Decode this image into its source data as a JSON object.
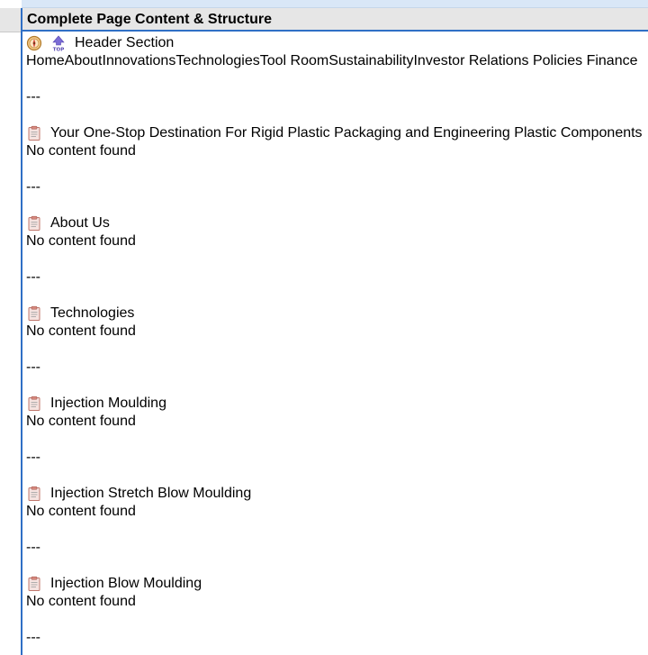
{
  "column_header": "Complete Page Content & Structure",
  "header_section": {
    "title": "Header Section",
    "nav_line": "HomeAboutInnovationsTechnologiesTool RoomSustainabilityInvestor Relations Policies Finance"
  },
  "separator": "---",
  "sections": [
    {
      "title": "Your One-Stop Destination For Rigid Plastic Packaging and Engineering Plastic Components",
      "body": "No content found"
    },
    {
      "title": "About Us",
      "body": "No content found"
    },
    {
      "title": "Technologies",
      "body": "No content found"
    },
    {
      "title": "Injection Moulding",
      "body": "No content found"
    },
    {
      "title": "Injection Stretch Blow Moulding",
      "body": "No content found"
    },
    {
      "title": "Injection Blow Moulding",
      "body": "No content found"
    }
  ],
  "icons": {
    "header": [
      "compass-icon",
      "top-arrow-icon"
    ],
    "section": "clipboard-icon"
  }
}
